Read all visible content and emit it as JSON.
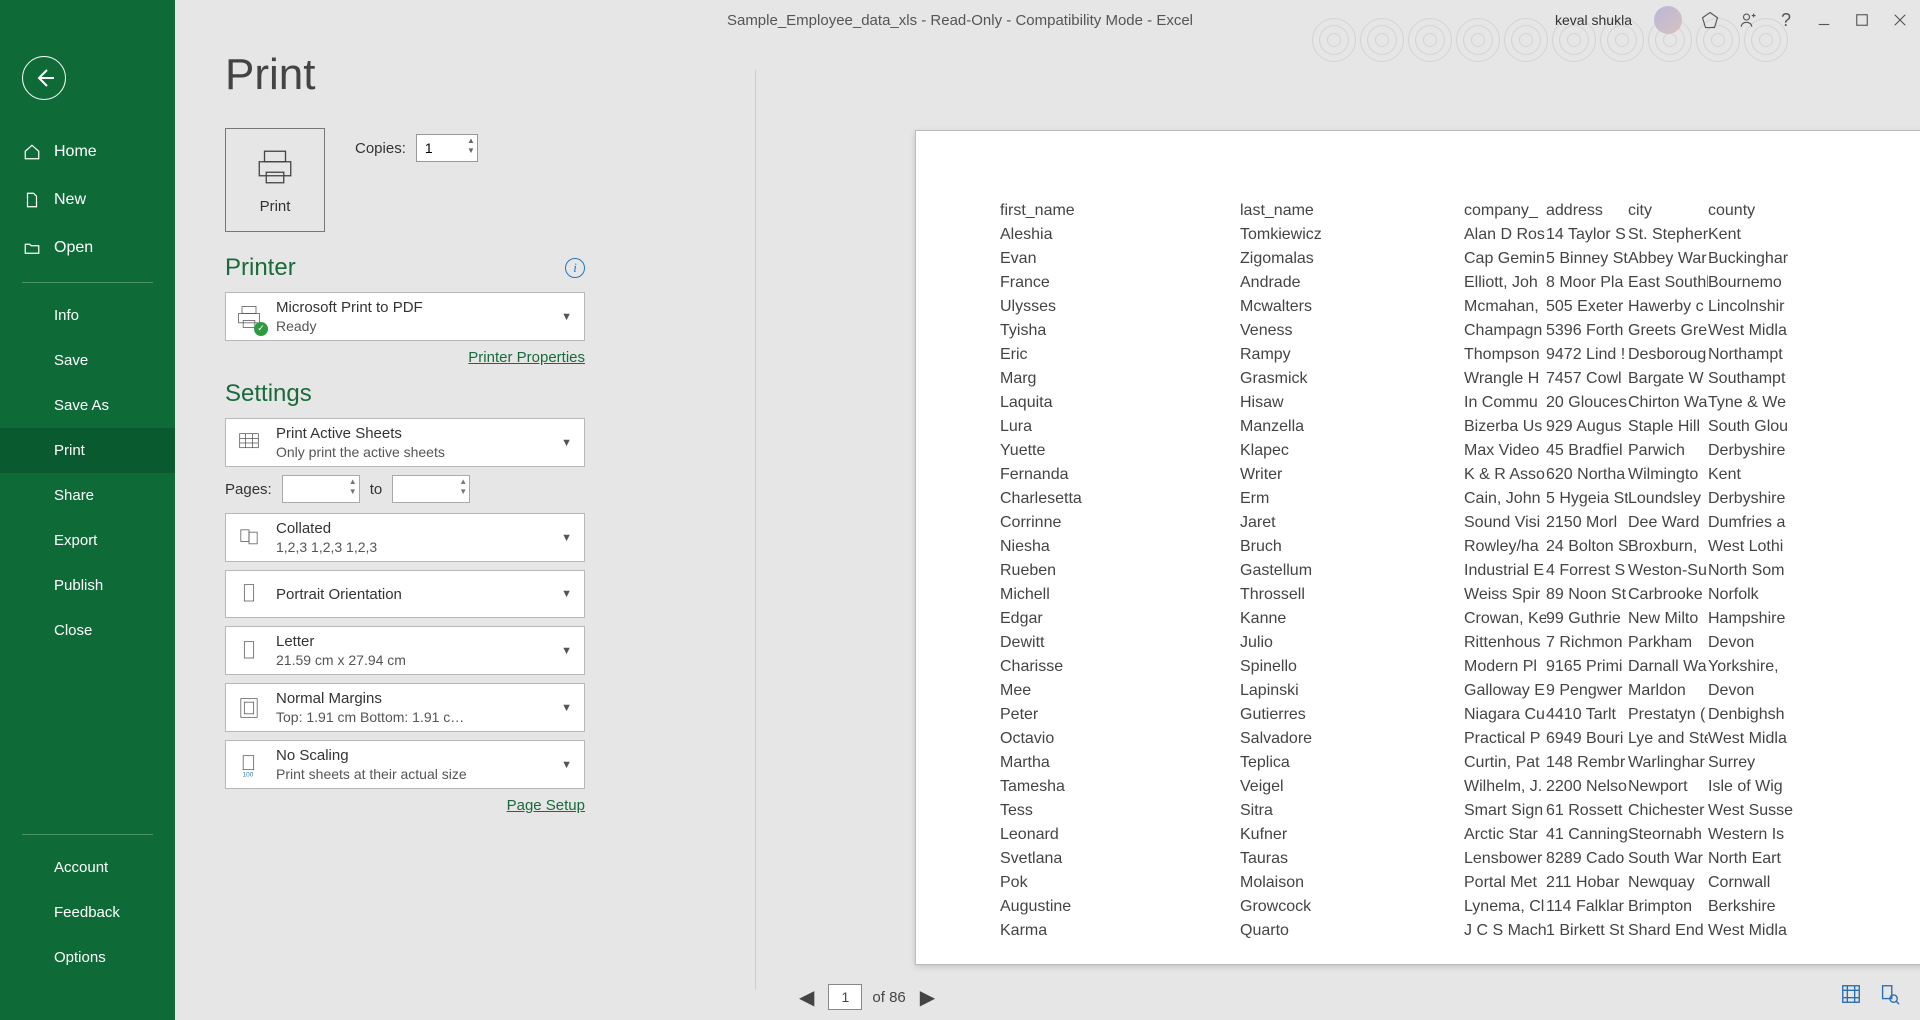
{
  "titlebar": {
    "document": "Sample_Employee_data_xls  -  Read-Only  -  Compatibility Mode  -  Excel",
    "user": "keval shukla"
  },
  "sidebar": {
    "home": "Home",
    "new": "New",
    "open": "Open",
    "info": "Info",
    "save": "Save",
    "saveAs": "Save As",
    "print": "Print",
    "share": "Share",
    "export": "Export",
    "publish": "Publish",
    "close": "Close",
    "account": "Account",
    "feedback": "Feedback",
    "options": "Options"
  },
  "pageTitle": "Print",
  "printBtn": "Print",
  "copies": {
    "label": "Copies:",
    "value": "1"
  },
  "printerSection": "Printer",
  "printer": {
    "name": "Microsoft Print to PDF",
    "status": "Ready"
  },
  "printerProperties": "Printer Properties",
  "settingsSection": "Settings",
  "settings": {
    "printActive": {
      "t1": "Print Active Sheets",
      "t2": "Only print the active sheets"
    },
    "pagesLabel": "Pages:",
    "to": "to",
    "collated": {
      "t1": "Collated",
      "t2": "1,2,3     1,2,3     1,2,3"
    },
    "orientation": {
      "t1": "Portrait Orientation"
    },
    "paper": {
      "t1": "Letter",
      "t2": "21.59 cm x 27.94 cm"
    },
    "margins": {
      "t1": "Normal Margins",
      "t2": "Top: 1.91 cm Bottom: 1.91 c…"
    },
    "scaling": {
      "t1": "No Scaling",
      "t2": "Print sheets at their actual size"
    }
  },
  "pageSetup": "Page Setup",
  "footer": {
    "page": "1",
    "of": "of 86"
  },
  "chart_data": {
    "type": "table",
    "columns": [
      "first_name",
      "last_name",
      "company_",
      "address",
      "city",
      "county"
    ],
    "rows": [
      [
        "Aleshia",
        "Tomkiewicz",
        "Alan D Ros",
        "14 Taylor S",
        "St. Stepher",
        "Kent"
      ],
      [
        "Evan",
        "Zigomalas",
        "Cap Gemin",
        "5 Binney St",
        "Abbey War",
        "Buckinghar"
      ],
      [
        "France",
        "Andrade",
        "Elliott, Joh",
        "8 Moor Pla",
        "East Southb",
        "Bournemo"
      ],
      [
        "Ulysses",
        "Mcwalters",
        "Mcmahan,",
        "505 Exeter",
        "Hawerby c",
        "Lincolnshir"
      ],
      [
        "Tyisha",
        "Veness",
        "Champagn",
        "5396 Forth",
        "Greets Gre",
        "West Midla"
      ],
      [
        "Eric",
        "Rampy",
        "Thompson",
        "9472 Lind !",
        "Desboroug",
        "Northampt"
      ],
      [
        "Marg",
        "Grasmick",
        "Wrangle H",
        "7457 Cowl",
        "Bargate W",
        "Southampt"
      ],
      [
        "Laquita",
        "Hisaw",
        "In Commu",
        "20 Glouces",
        "Chirton Wa",
        "Tyne & We"
      ],
      [
        "Lura",
        "Manzella",
        "Bizerba Us",
        "929 Augus",
        "Staple Hill",
        "South Glou"
      ],
      [
        "Yuette",
        "Klapec",
        "Max Video",
        "45 Bradfiel",
        "Parwich",
        "Derbyshire"
      ],
      [
        "Fernanda",
        "Writer",
        "K & R Asso",
        "620 Northa",
        "Wilmingto",
        "Kent"
      ],
      [
        "Charlesetta",
        "Erm",
        "Cain, John",
        "5 Hygeia St",
        "Loundsley",
        "Derbyshire"
      ],
      [
        "Corrinne",
        "Jaret",
        "Sound Visi",
        "2150 Morl",
        "Dee Ward",
        "Dumfries a"
      ],
      [
        "Niesha",
        "Bruch",
        "Rowley/ha",
        "24 Bolton S",
        "Broxburn,",
        "West Lothi"
      ],
      [
        "Rueben",
        "Gastellum",
        "Industrial E",
        "4 Forrest S",
        "Weston-Su",
        "North Som"
      ],
      [
        "Michell",
        "Throssell",
        "Weiss Spir",
        "89 Noon St",
        "Carbrooke",
        "Norfolk"
      ],
      [
        "Edgar",
        "Kanne",
        "Crowan, Ke",
        "99 Guthrie",
        "New Milto",
        "Hampshire"
      ],
      [
        "Dewitt",
        "Julio",
        "Rittenhous",
        "7 Richmon",
        "Parkham",
        "Devon"
      ],
      [
        "Charisse",
        "Spinello",
        "Modern Pl",
        "9165 Primi",
        "Darnall Wa",
        "Yorkshire,"
      ],
      [
        "Mee",
        "Lapinski",
        "Galloway E",
        "9 Pengwer",
        "Marldon",
        "Devon"
      ],
      [
        "Peter",
        "Gutierres",
        "Niagara Cu",
        "4410 Tarlt",
        "Prestatyn (",
        "Denbighsh"
      ],
      [
        "Octavio",
        "Salvadore",
        "Practical P",
        "6949 Bouri",
        "Lye and Ste",
        "West Midla"
      ],
      [
        "Martha",
        "Teplica",
        "Curtin, Pat",
        "148 Rembr",
        "Warlinghar",
        "Surrey"
      ],
      [
        "Tamesha",
        "Veigel",
        "Wilhelm, J.",
        "2200 Nelso",
        "Newport",
        "Isle of Wig"
      ],
      [
        "Tess",
        "Sitra",
        "Smart Sign",
        "61 Rossett",
        "Chichester",
        "West Susse"
      ],
      [
        "Leonard",
        "Kufner",
        "Arctic Star",
        "41 Canning",
        "Steornabh",
        "Western Is"
      ],
      [
        "Svetlana",
        "Tauras",
        "Lensbower",
        "8289 Cado",
        "South War",
        "North Eart"
      ],
      [
        "Pok",
        "Molaison",
        "Portal Met",
        "211 Hobar",
        "Newquay",
        "Cornwall"
      ],
      [
        "Augustine",
        "Growcock",
        "Lynema, Cl",
        "114 Falklar",
        "Brimpton",
        "Berkshire"
      ],
      [
        "Karma",
        "Quarto",
        "J C S Mach",
        "1 Birkett St",
        "Shard End",
        "West Midla"
      ]
    ]
  }
}
